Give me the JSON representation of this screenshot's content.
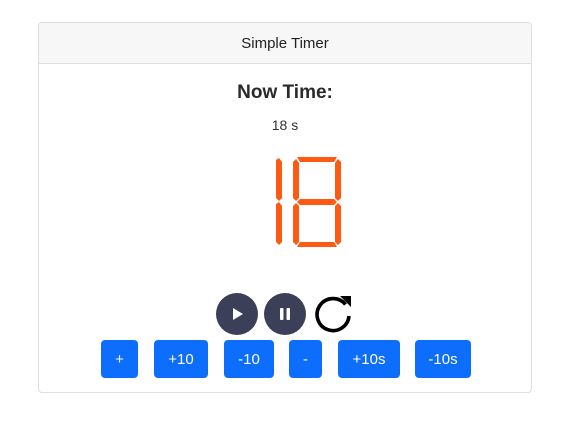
{
  "header": {
    "title": "Simple Timer"
  },
  "timer": {
    "heading": "Now Time:",
    "seconds_text": "18 s",
    "value": 18,
    "display_color": "#ff5a14"
  },
  "controls": {
    "play_icon": "play-icon",
    "pause_icon": "pause-icon",
    "reset_icon": "reset-icon"
  },
  "adjust_buttons": [
    "+",
    "+10",
    "-10",
    "-",
    "+10s",
    "-10s"
  ],
  "colors": {
    "accent": "#0d6efd",
    "control_bg": "#3b3f58"
  }
}
